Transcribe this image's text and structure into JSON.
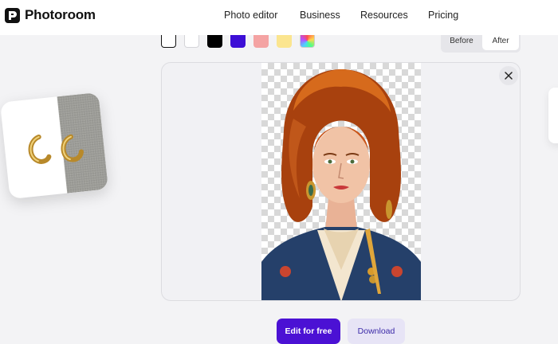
{
  "brand": {
    "name": "Photoroom"
  },
  "nav": {
    "items": [
      {
        "label": "Photo editor"
      },
      {
        "label": "Business"
      },
      {
        "label": "Resources"
      },
      {
        "label": "Pricing"
      }
    ]
  },
  "swatches": [
    {
      "color": "#ffffff",
      "selected": true,
      "name": "white-outline"
    },
    {
      "color": "#ffffff",
      "selected": false,
      "name": "white"
    },
    {
      "color": "#000000",
      "selected": false,
      "name": "black"
    },
    {
      "color": "#3d0fd6",
      "selected": false,
      "name": "purple"
    },
    {
      "color": "#f4a3a3",
      "selected": false,
      "name": "pink"
    },
    {
      "color": "#fbe58f",
      "selected": false,
      "name": "yellow"
    },
    {
      "color": "rainbow",
      "selected": false,
      "name": "gradient"
    }
  ],
  "toggle": {
    "before_label": "Before",
    "after_label": "After",
    "active": "After"
  },
  "canvas": {
    "close_icon": "close-icon"
  },
  "actions": {
    "edit_label": "Edit for free",
    "download_label": "Download"
  },
  "colors": {
    "accent": "#4b11d4",
    "accent_soft": "#e7e4f6",
    "background": "#f3f3f5"
  }
}
